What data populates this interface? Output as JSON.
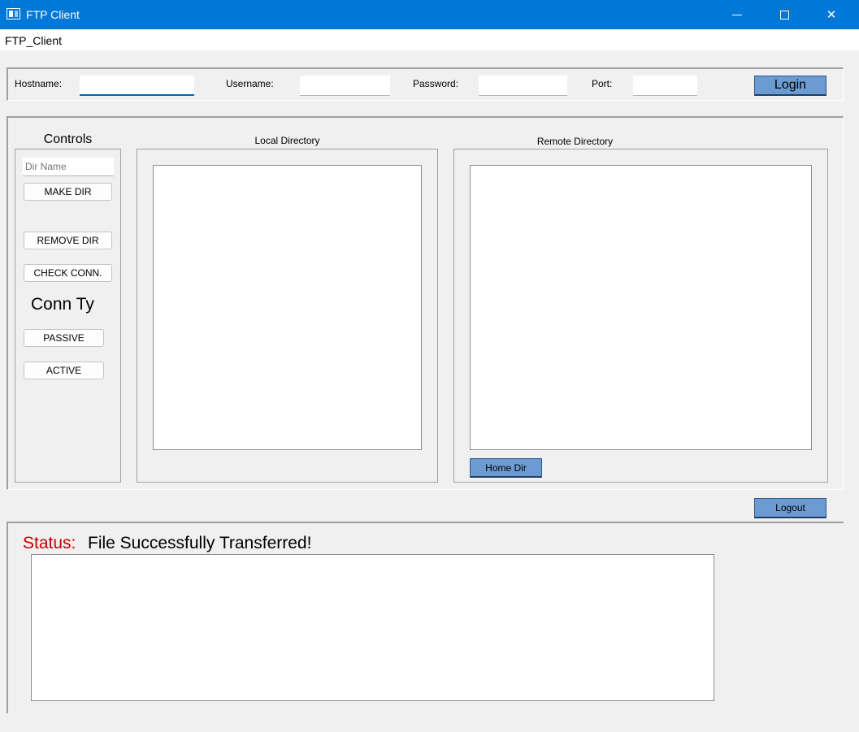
{
  "window": {
    "title": "FTP Client",
    "icon": "app-window-icon",
    "controls": {
      "minimize_icon": "minimize-icon",
      "maximize_icon": "maximize-icon",
      "close_icon": "close-icon",
      "close_glyph": "✕"
    }
  },
  "menu": {
    "items": [
      "FTP_Client"
    ]
  },
  "login": {
    "hostname_label": "Hostname:",
    "hostname_value": "",
    "username_label": "Username:",
    "username_value": "",
    "password_label": "Password:",
    "password_value": "",
    "port_label": "Port:",
    "port_value": "",
    "login_button": "Login"
  },
  "controls": {
    "title": "Controls",
    "dir_name_placeholder": "Dir Name",
    "dir_name_value": "",
    "make_dir": "MAKE DIR",
    "remove_dir": "REMOVE DIR",
    "check_conn": "CHECK CONN.",
    "conn_type_label": "Conn Ty",
    "passive": "PASSIVE",
    "active": "ACTIVE"
  },
  "local_directory": {
    "title": "Local Directory",
    "items": []
  },
  "remote_directory": {
    "title": "Remote Directory",
    "items": [],
    "home_dir_button": "Home Dir"
  },
  "logout_button": "Logout",
  "status": {
    "label": "Status:",
    "message": "File Successfully Transferred!",
    "label_color": "#c00000",
    "log": ""
  },
  "colors": {
    "titlebar": "#0078d7",
    "accent_button": "#6b9bd0",
    "background": "#f0f0f0"
  }
}
